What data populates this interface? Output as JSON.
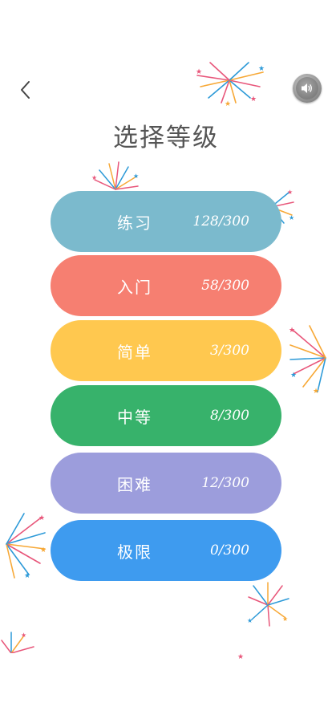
{
  "header": {
    "title": "选择等级"
  },
  "levels": [
    {
      "name": "练习",
      "progress": "128/300",
      "color": "#7bbacd"
    },
    {
      "name": "入门",
      "progress": "58/300",
      "color": "#f67f71"
    },
    {
      "name": "简单",
      "progress": "3/300",
      "color": "#ffc84f"
    },
    {
      "name": "中等",
      "progress": "8/300",
      "color": "#37b26b"
    },
    {
      "name": "困难",
      "progress": "12/300",
      "color": "#9c9ddc"
    },
    {
      "name": "极限",
      "progress": "0/300",
      "color": "#3e9bef"
    }
  ],
  "icons": {
    "back": "chevron-left-icon",
    "sound": "speaker-icon",
    "decor": "firework-icon"
  }
}
